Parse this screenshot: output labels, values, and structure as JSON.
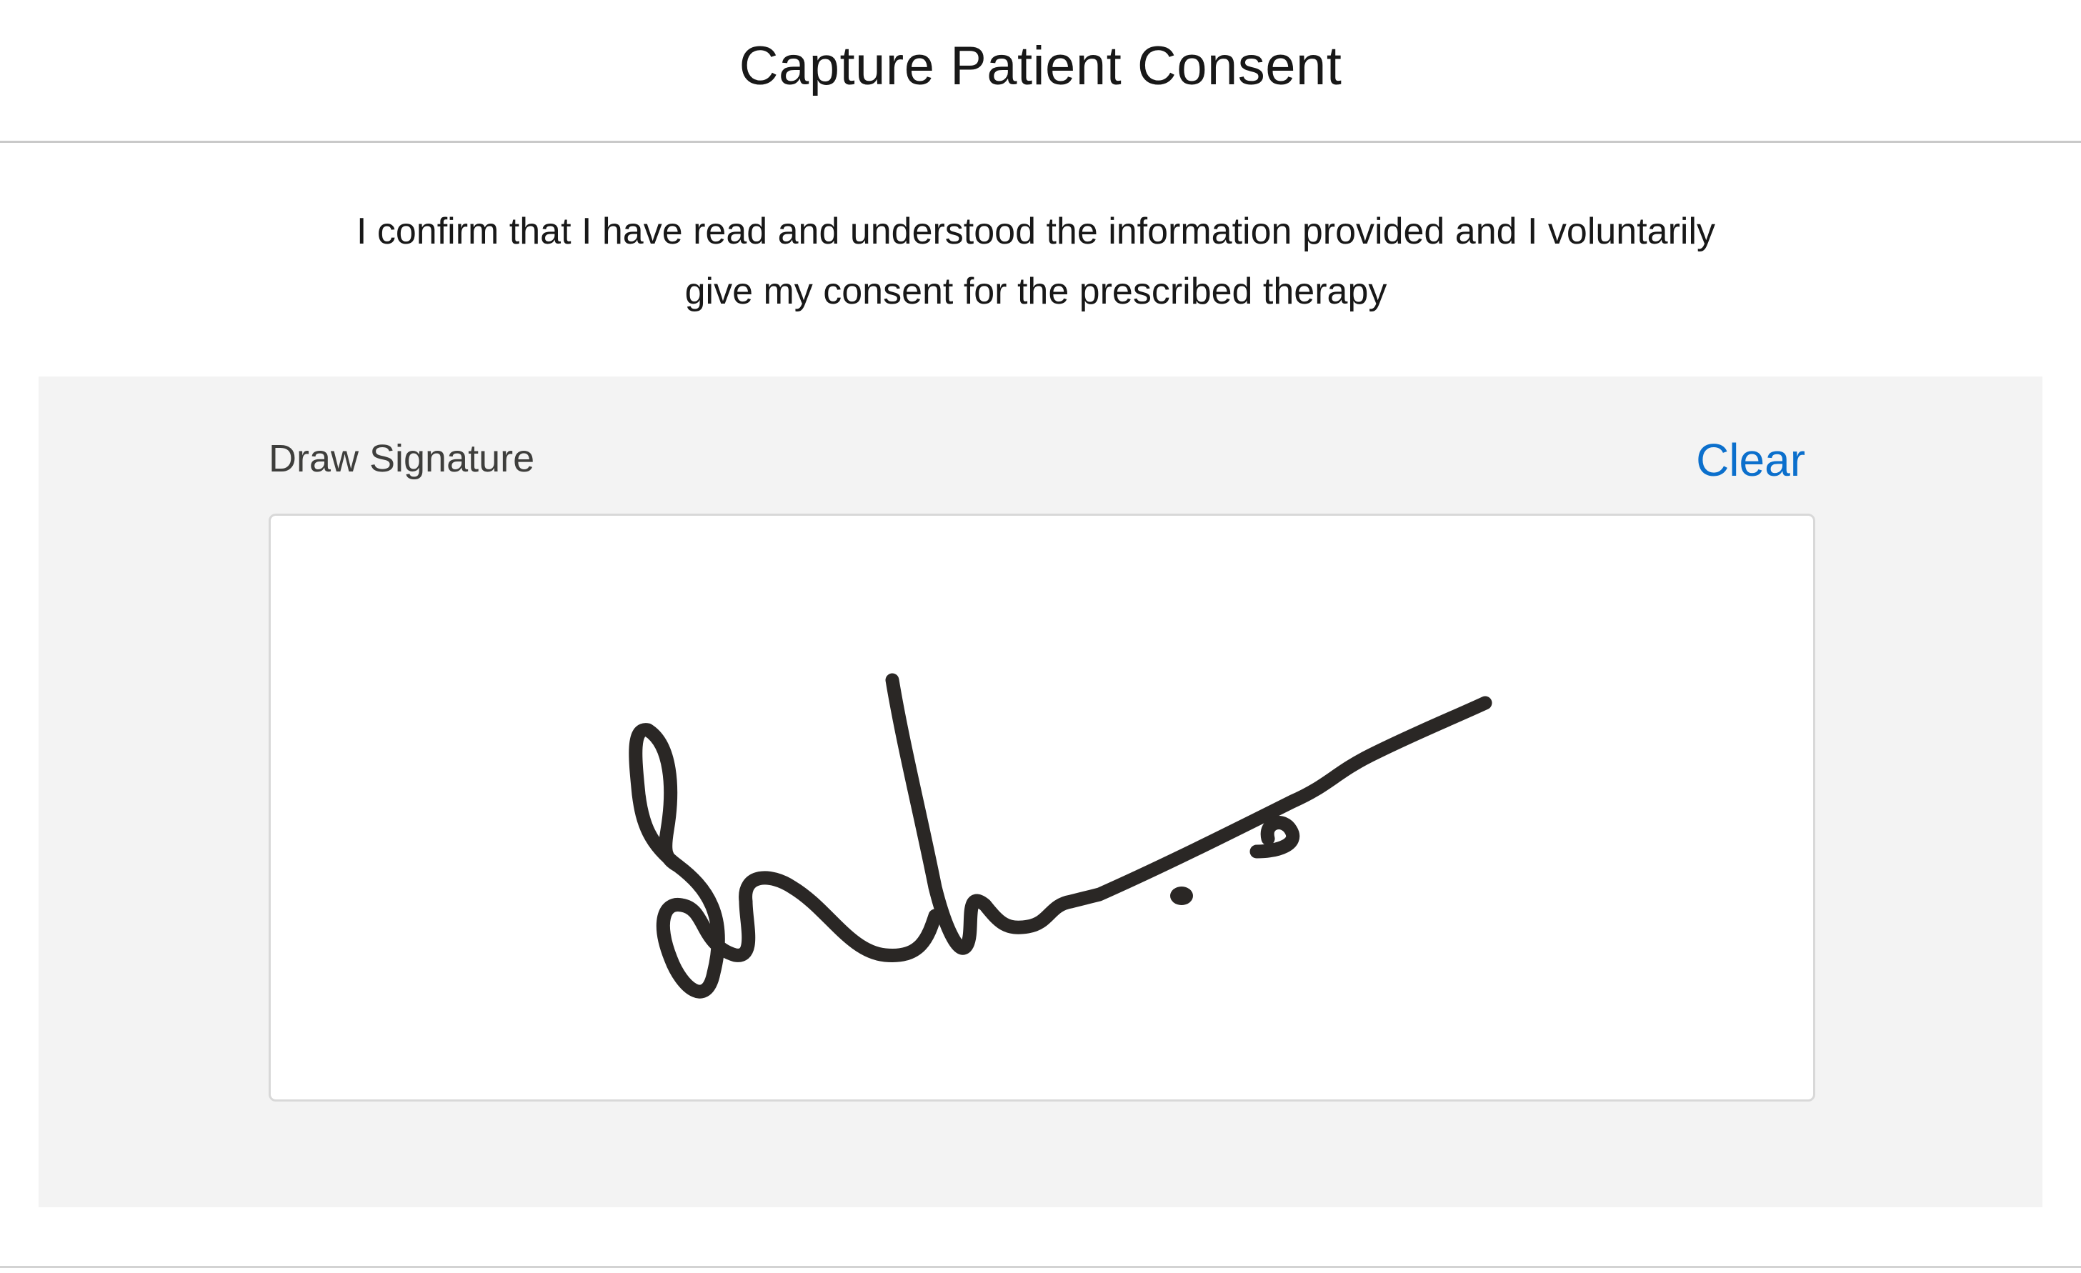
{
  "header": {
    "title": "Capture Patient Consent"
  },
  "consent": {
    "line1": "I confirm that I have read and understood the information provided and I voluntarily",
    "line2": "give my consent for the prescribed therapy"
  },
  "signature": {
    "label": "Draw Signature",
    "clear_label": "Clear",
    "stroke_color": "#2a2725"
  },
  "colors": {
    "link": "#0b6fcc",
    "panel_background": "#f3f3f3",
    "divider": "#c9c9c9"
  }
}
